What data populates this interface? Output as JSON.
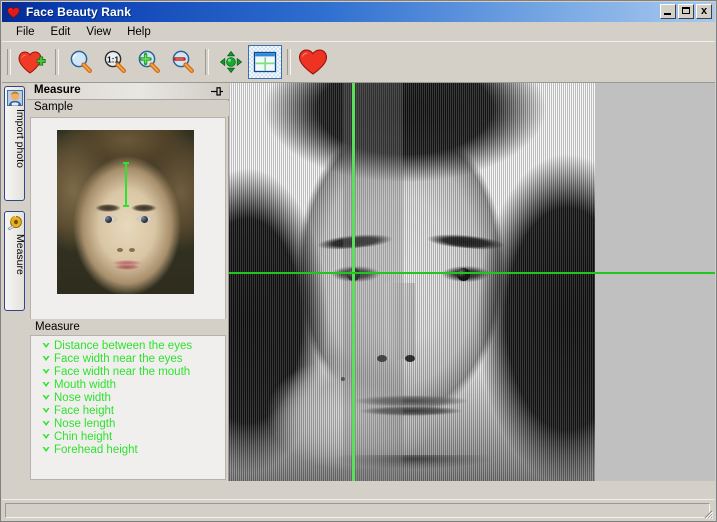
{
  "window": {
    "title": "Face Beauty Rank",
    "icon": "heart-icon",
    "controls": {
      "minimize": "_",
      "maximize": "□",
      "close": "✕"
    }
  },
  "menubar": {
    "items": [
      {
        "label": "File"
      },
      {
        "label": "Edit"
      },
      {
        "label": "View"
      },
      {
        "label": "Help"
      }
    ]
  },
  "toolbar": {
    "buttons": [
      {
        "name": "add-face-button",
        "icon": "heart-plus-icon",
        "tooltip": "Add face",
        "active": false
      },
      {
        "name": "zoom-tool-button",
        "icon": "magnifier-icon",
        "tooltip": "Zoom",
        "active": false
      },
      {
        "name": "zoom-actual-button",
        "icon": "magnifier-1to1-icon",
        "tooltip": "1:1",
        "active": false
      },
      {
        "name": "zoom-in-button",
        "icon": "magnifier-plus-icon",
        "tooltip": "Zoom in",
        "active": false
      },
      {
        "name": "zoom-out-button",
        "icon": "magnifier-minus-icon",
        "tooltip": "Zoom out",
        "active": false
      },
      {
        "name": "pan-tool-button",
        "icon": "move-arrows-icon",
        "tooltip": "Pan",
        "active": false
      },
      {
        "name": "crosshair-tool-button",
        "icon": "crosshair-window-icon",
        "tooltip": "Show crosshair",
        "active": true
      },
      {
        "name": "rank-button",
        "icon": "heart-icon",
        "tooltip": "Rank beauty",
        "active": false
      }
    ],
    "zoom_label_1to1": "1:1"
  },
  "tabstrip": {
    "tabs": [
      {
        "label": "Import photo",
        "icon": "person-portrait-icon",
        "selected": false
      },
      {
        "label": "Measure",
        "icon": "tape-measure-icon",
        "selected": true
      }
    ]
  },
  "panel": {
    "title": "Measure",
    "pin_icon": "pushpin-icon",
    "sample": {
      "label": "Sample",
      "overlay": "forehead-height-line"
    },
    "measure": {
      "label": "Measure",
      "bullet_icon": "green-chevron-icon",
      "items": [
        {
          "label": "Distance between the eyes"
        },
        {
          "label": "Face width near the eyes"
        },
        {
          "label": "Face width near the mouth"
        },
        {
          "label": "Mouth width"
        },
        {
          "label": "Nose width"
        },
        {
          "label": "Face height"
        },
        {
          "label": "Nose length"
        },
        {
          "label": "Chin height"
        },
        {
          "label": "Forehead height"
        }
      ]
    }
  },
  "canvas": {
    "name": "measurement-canvas",
    "photo": "grayscale-face-photo",
    "overlays": {
      "vertical_crosshair": "vertical-guide-line",
      "horizontal_crosshair": "horizontal-guide-line",
      "symmetry_band": "symmetry-band"
    }
  },
  "statusbar": {
    "text": ""
  },
  "colors": {
    "titlebar_start": "#06298f",
    "titlebar_end": "#a8c9ef",
    "window_face": "#d4d0c8",
    "panel_field": "#f0efed",
    "measure_green": "#2ee22e",
    "guide_green": "#1fc81f",
    "tab_border_blue": "#32458e",
    "active_button_blue": "#3c6fb0",
    "canvas_gray": "#c0c0c0",
    "heart_red": "#e02020"
  }
}
